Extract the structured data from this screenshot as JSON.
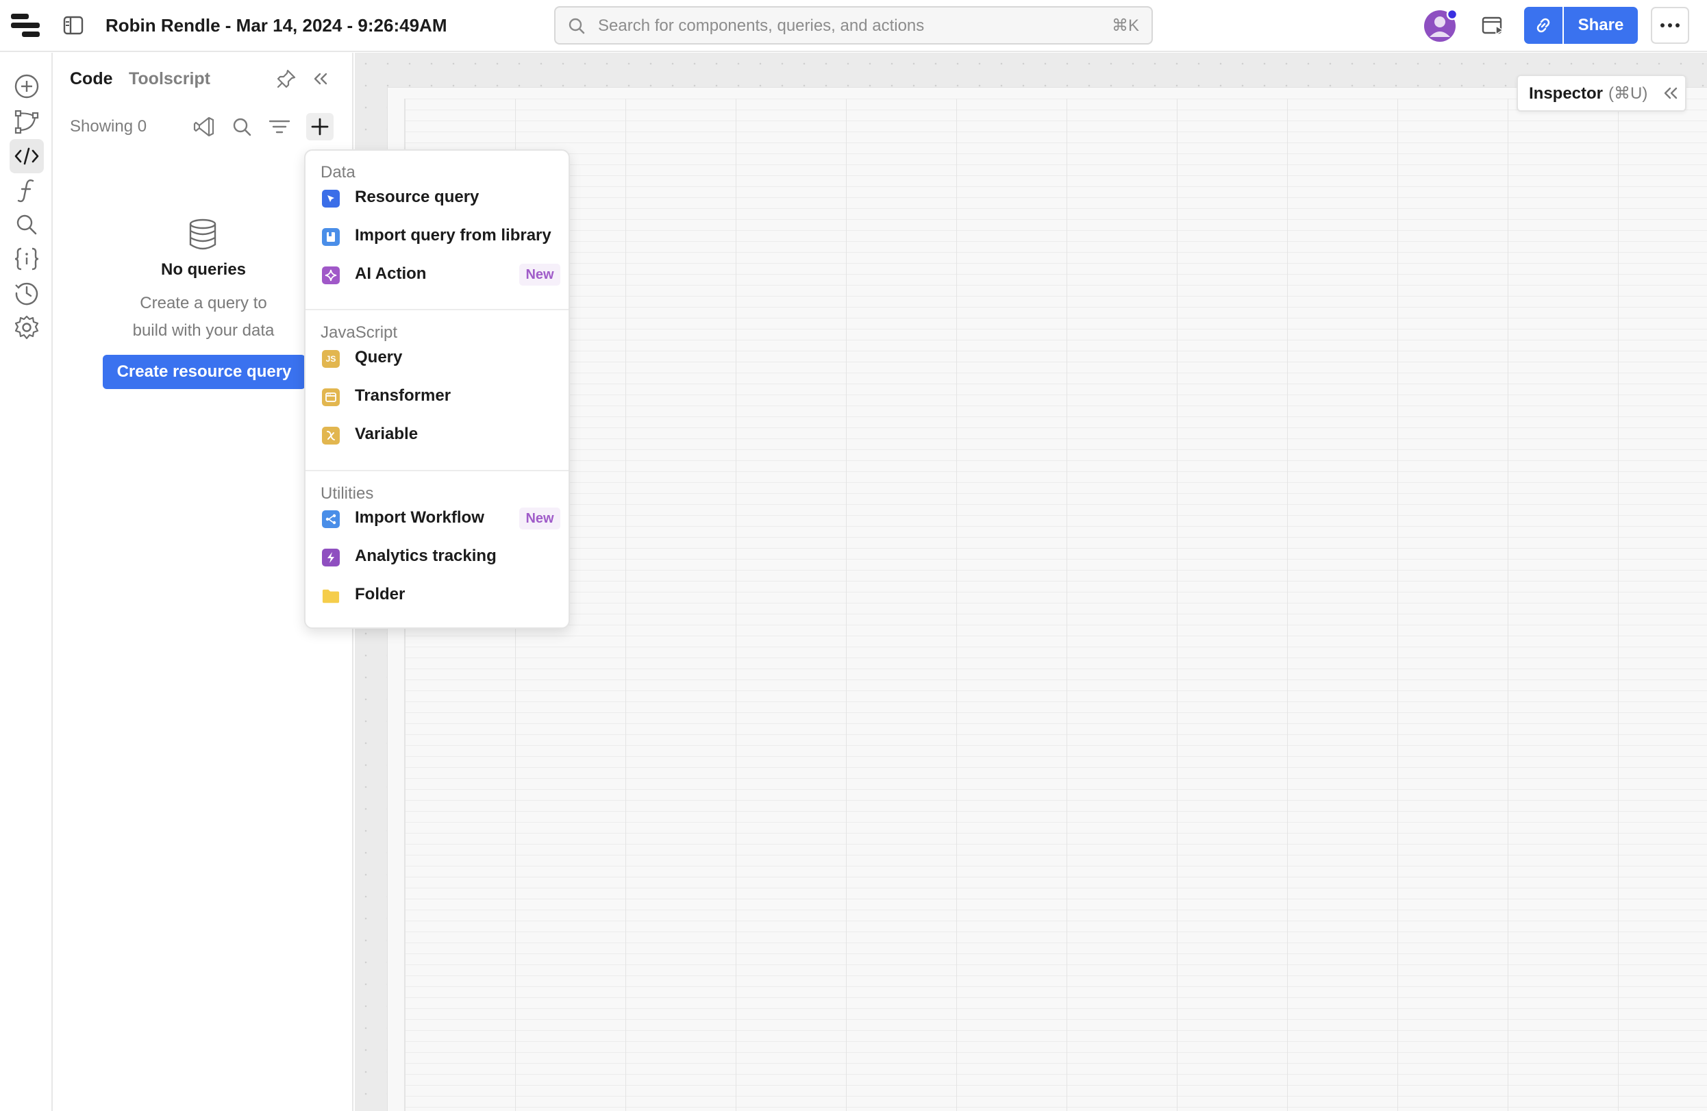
{
  "app": {
    "title": "Robin Rendle - Mar 14, 2024 - 9:26:49AM"
  },
  "search": {
    "placeholder": "Search for components, queries, and actions",
    "shortcut": "⌘K"
  },
  "header": {
    "share_label": "Share"
  },
  "panel": {
    "tabs": [
      {
        "label": "Code",
        "active": true
      },
      {
        "label": "Toolscript",
        "active": false
      }
    ],
    "showing": "Showing 0",
    "empty": {
      "title": "No queries",
      "subtitle_line1": "Create a query to",
      "subtitle_line2": "build with your data",
      "button": "Create resource query"
    }
  },
  "menu": {
    "sections": [
      {
        "title": "Data",
        "items": [
          {
            "label": "Resource query",
            "icon": "resource-query-icon",
            "color": "#3b6ee8"
          },
          {
            "label": "Import query from library",
            "icon": "library-icon",
            "color": "#4a8ee8"
          },
          {
            "label": "AI Action",
            "icon": "ai-sparkle-icon",
            "color": "#a058c8",
            "badge": "New"
          }
        ]
      },
      {
        "title": "JavaScript",
        "items": [
          {
            "label": "Query",
            "icon": "js-icon",
            "color": "#e2b64f",
            "glyph": "JS"
          },
          {
            "label": "Transformer",
            "icon": "transformer-icon",
            "color": "#e2b64f"
          },
          {
            "label": "Variable",
            "icon": "variable-icon",
            "color": "#e2b64f"
          }
        ]
      },
      {
        "title": "Utilities",
        "items": [
          {
            "label": "Import Workflow",
            "icon": "workflow-icon",
            "color": "#4a8ee8",
            "badge": "New"
          },
          {
            "label": "Analytics tracking",
            "icon": "analytics-icon",
            "color": "#8f4fc0"
          },
          {
            "label": "Folder",
            "icon": "folder-icon",
            "color": "#f5cd4b"
          }
        ]
      }
    ]
  },
  "inspector": {
    "label": "Inspector",
    "shortcut": "(⌘U)"
  },
  "colors": {
    "accent": "#3a72ef",
    "badge_text": "#a05cc9",
    "badge_bg": "#f6f0fa"
  }
}
